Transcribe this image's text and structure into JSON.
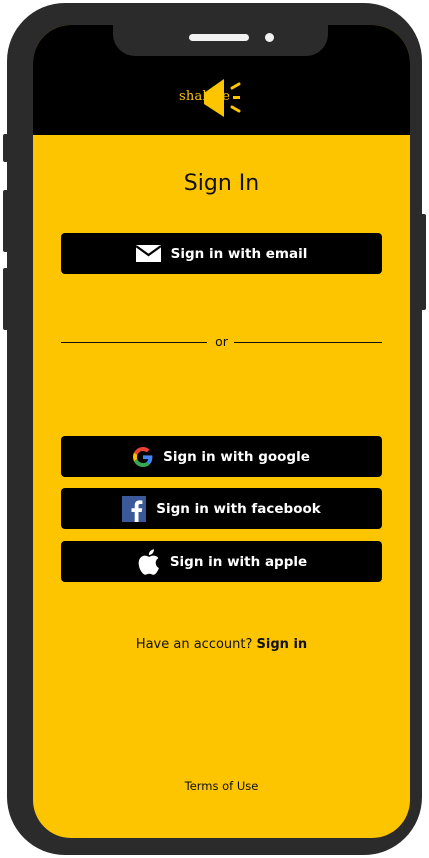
{
  "brand": {
    "logo_text": "shalaye"
  },
  "page": {
    "title": "Sign In"
  },
  "buttons": {
    "email": {
      "label": "Sign in with email",
      "icon": "envelope-icon"
    },
    "google": {
      "label": "Sign in with google",
      "icon": "google-icon"
    },
    "facebook": {
      "label": "Sign in with facebook",
      "icon": "facebook-icon"
    },
    "apple": {
      "label": "Sign in with apple",
      "icon": "apple-icon"
    }
  },
  "divider": {
    "text": "or"
  },
  "footer": {
    "account_prompt": "Have an account?",
    "account_link": "Sign in",
    "terms": "Terms of Use"
  },
  "colors": {
    "accent": "#fdc400",
    "button_bg": "#000000",
    "frame": "#2b2b2b"
  }
}
